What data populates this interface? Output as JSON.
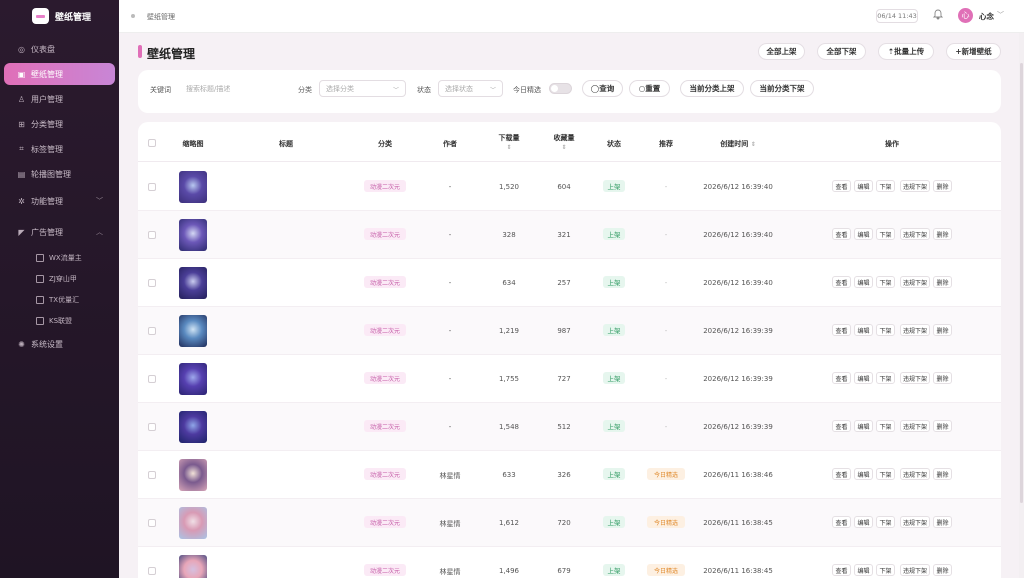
{
  "app": {
    "title": "壁纸管理"
  },
  "sidebar": {
    "items": [
      {
        "label": "仪表盘",
        "icon": "dashboard-icon"
      },
      {
        "label": "壁纸管理",
        "icon": "image-icon",
        "active": true
      },
      {
        "label": "用户管理",
        "icon": "user-icon"
      },
      {
        "label": "分类管理",
        "icon": "grid-icon"
      },
      {
        "label": "标签管理",
        "icon": "tag-icon"
      },
      {
        "label": "轮播图管理",
        "icon": "carousel-icon"
      },
      {
        "label": "功能管理",
        "icon": "settings-icon",
        "expandable": true
      },
      {
        "label": "广告管理",
        "icon": "megaphone-icon",
        "expanded": true
      },
      {
        "label": "系统设置",
        "icon": "gear-icon"
      }
    ],
    "ad_sub_items": [
      {
        "label": "WX流量主"
      },
      {
        "label": "ZJ穿山甲"
      },
      {
        "label": "TX优量汇"
      },
      {
        "label": "KS联盟"
      }
    ]
  },
  "topbar": {
    "breadcrumb": "壁纸管理",
    "time": "06/14 11:43",
    "user_avatar": "心",
    "user_name": "心念"
  },
  "header": {
    "title": "壁纸管理",
    "buttons": [
      "全部上架",
      "全部下架",
      "⇡批量上传",
      "+新增壁纸"
    ]
  },
  "filters": {
    "keyword_label": "关键词",
    "keyword_placeholder": "搜索标题/描述",
    "category_label": "分类",
    "category_placeholder": "选择分类",
    "status_label": "状态",
    "status_placeholder": "选择状态",
    "featured_label": "今日精选",
    "featured_on": false,
    "buttons": [
      "◯查询",
      "○重置",
      "当前分类上架",
      "当前分类下架"
    ]
  },
  "table": {
    "columns": [
      "缩略图",
      "标题",
      "分类",
      "作者",
      "下载量",
      "收藏量",
      "状态",
      "推荐",
      "创建时间",
      "操作"
    ],
    "actions": [
      "查看",
      "编辑",
      "下架",
      "违规下架",
      "删除"
    ],
    "rows": [
      {
        "title": "",
        "category": "动漫二次元",
        "author": "-",
        "downloads": "1,520",
        "favorites": "604",
        "status": "上架",
        "recommend": "-",
        "created": "2026/6/12 16:39:40",
        "thumb_colors": [
          "#3b2f7a",
          "#b8c8f0",
          "#5a4aa8"
        ]
      },
      {
        "title": "",
        "category": "动漫二次元",
        "author": "-",
        "downloads": "328",
        "favorites": "321",
        "status": "上架",
        "recommend": "-",
        "created": "2026/6/12 16:39:40",
        "thumb_colors": [
          "#2c2a6e",
          "#d4d8f4",
          "#6c58b8"
        ]
      },
      {
        "title": "",
        "category": "动漫二次元",
        "author": "-",
        "downloads": "634",
        "favorites": "257",
        "status": "上架",
        "recommend": "-",
        "created": "2026/6/12 16:39:40",
        "thumb_colors": [
          "#231f5a",
          "#c9ccef",
          "#4b3f98"
        ]
      },
      {
        "title": "",
        "category": "动漫二次元",
        "author": "-",
        "downloads": "1,219",
        "favorites": "987",
        "status": "上架",
        "recommend": "-",
        "created": "2026/6/12 16:39:39",
        "thumb_colors": [
          "#1f2c5a",
          "#cfe3f4",
          "#5a8ac0"
        ]
      },
      {
        "title": "",
        "category": "动漫二次元",
        "author": "-",
        "downloads": "1,755",
        "favorites": "727",
        "status": "上架",
        "recommend": "-",
        "created": "2026/6/12 16:39:39",
        "thumb_colors": [
          "#2a2370",
          "#9ea8ec",
          "#5640b0"
        ]
      },
      {
        "title": "",
        "category": "动漫二次元",
        "author": "-",
        "downloads": "1,548",
        "favorites": "512",
        "status": "上架",
        "recommend": "-",
        "created": "2026/6/12 16:39:39",
        "thumb_colors": [
          "#1d2368",
          "#8fa6e8",
          "#4d3aa0"
        ]
      },
      {
        "title": "",
        "category": "动漫二次元",
        "author": "林星情",
        "downloads": "633",
        "favorites": "326",
        "status": "上架",
        "recommend": "今日精选",
        "created": "2026/6/11 16:38:46",
        "thumb_colors": [
          "#d7a6b8",
          "#f2e2d8",
          "#7a5a8e"
        ]
      },
      {
        "title": "",
        "category": "动漫二次元",
        "author": "林星情",
        "downloads": "1,612",
        "favorites": "720",
        "status": "上架",
        "recommend": "今日精选",
        "created": "2026/6/11 16:38:45",
        "thumb_colors": [
          "#a9c4e6",
          "#f0dfe6",
          "#d89ab4"
        ]
      },
      {
        "title": "",
        "category": "动漫二次元",
        "author": "林星情",
        "downloads": "1,496",
        "favorites": "679",
        "status": "上架",
        "recommend": "今日精选",
        "created": "2026/6/11 16:38:45",
        "thumb_colors": [
          "#2f3c78",
          "#d5c0e0",
          "#e8a6b8"
        ]
      }
    ]
  },
  "colors": {
    "accent": "#e06fb8",
    "sidebar_bg": "#2b1a2e",
    "status_green": "#2f9a62",
    "recommend_orange": "#e08a2c",
    "category_pink": "#c45aa6"
  }
}
